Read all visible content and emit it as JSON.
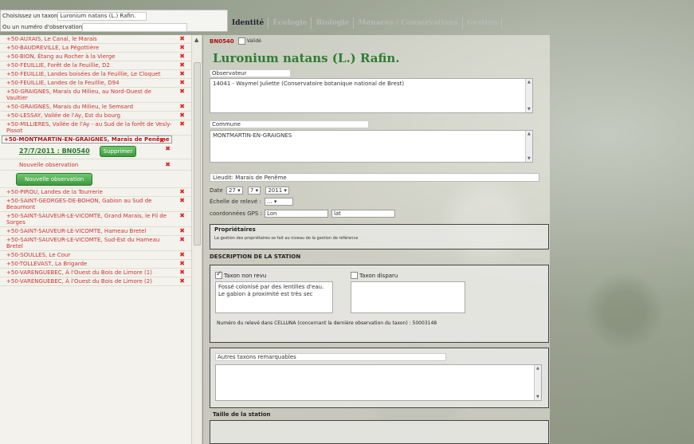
{
  "search": {
    "label1": "Choisissez un taxon",
    "value1": "Luronium natans (L.) Rafin.",
    "label2": "Ou un numéro d'observation",
    "value2": ""
  },
  "tabs": [
    {
      "label": "Identité"
    },
    {
      "label": "Écologie"
    },
    {
      "label": "Biologie"
    },
    {
      "label": "Menaces / Conservations"
    },
    {
      "label": "Gestion"
    }
  ],
  "locations": [
    {
      "text": "+50-AUXAIS, Le Canal, le Marais"
    },
    {
      "text": "+50-BAUDREVILLE, La Pégottière"
    },
    {
      "text": "+50-BION, Étang au Rocher à la Vierge"
    },
    {
      "text": "+50-FEUILLIE, Forêt de la Feuillie, D2"
    },
    {
      "text": "+50-FEUILLIE, Landes boisées de la Feuillie, Le Cloquet"
    },
    {
      "text": "+50-FEUILLIE, Landes de la Feuillie, D94"
    },
    {
      "text": "+50-GRAIGNES, Marais du Milieu, au Nord-Ouest de Vaultier"
    },
    {
      "text": "+50-GRAIGNES, Marais du Milieu, le Semsard"
    },
    {
      "text": "+50-LESSAY, Vallée de l'Ay, Est du bourg"
    },
    {
      "text": "+50-MILLIERES, Vallée de l'Ay - au Sud de la forêt de Vesly-Pissot"
    },
    {
      "text": "+50-MONTMARTIN-EN-GRAIGNES, Marais de Penême",
      "selected": true
    }
  ],
  "observation": {
    "link": "27/7/2011 : BN0540",
    "button": "Supprimer"
  },
  "new_observation_label": "Nouvelle observation",
  "new_observation_button": "Nouvelle observation",
  "locations_after": [
    {
      "text": "+50-PIROU, Landes de la Tourrerie"
    },
    {
      "text": "+50-SAINT-GEORGES-DE-BOHON, Gabion au Sud de Beaumont"
    },
    {
      "text": "+50-SAINT-SAUVEUR-LE-VICOMTE, Grand Marais, le Fil de Sorges"
    },
    {
      "text": "+50-SAINT-SAUVEUR-LE-VICOMTE, Hameau Bretel"
    },
    {
      "text": "+50-SAINT-SAUVEUR-LE-VICOMTE, Sud-Est du Hameau Bretel"
    },
    {
      "text": "+50-SOULLES, Le Cour"
    },
    {
      "text": "+50-TOLLEVAST, La Brigarde"
    },
    {
      "text": "+50-VARENGUEBEC, À l'Ouest du Bois de Limore (1)"
    },
    {
      "text": "+50-VARENGUEBEC, À l'Ouest du Bois de Limore (2)"
    }
  ],
  "delete_glyph": "✖",
  "record": {
    "id": "BN0540",
    "checkbox_label": "Validé",
    "species": "Luronium natans (L.) Rafin."
  },
  "form": {
    "observateur_label": "Observateur",
    "observateur_value": "14041 - Waymel Juliette (Conservatoire botanique national de Brest)",
    "commune_label": "Commune",
    "commune_value": "MONTMARTIN-EN-GRAIGNES",
    "lieudit": "Lieudit: Marais de Penême",
    "date_label": "Date",
    "date_day": "27",
    "date_month": "7",
    "date_year": "2011",
    "echelle_label": "Échelle de relevé :",
    "echelle_value": "...",
    "gps_label": "coordonnées GPS :",
    "gps_lon_label": "Lon",
    "gps_lat_label": "lat",
    "proprietaires_title": "Propriétaires",
    "proprietaires_sub": "La gestion des propriétaires se fait au niveau de la gestion de référence",
    "description_title": "DESCRIPTION DE LA STATION",
    "taxon_revu_label": "Taxon non revu",
    "taxon_disparu_label": "Taxon disparu",
    "taxon_revu_text": "Fossé colonisé par des lentilles d'eau. Le gabion à proximité est très sec",
    "numero_releve": "Numéro du relevé dans CELLUNA (concernant la dernière observation du taxon) : 50003148",
    "autres_taxons_label": "Autres taxons remarquables",
    "taille_title": "Taille de la station"
  }
}
